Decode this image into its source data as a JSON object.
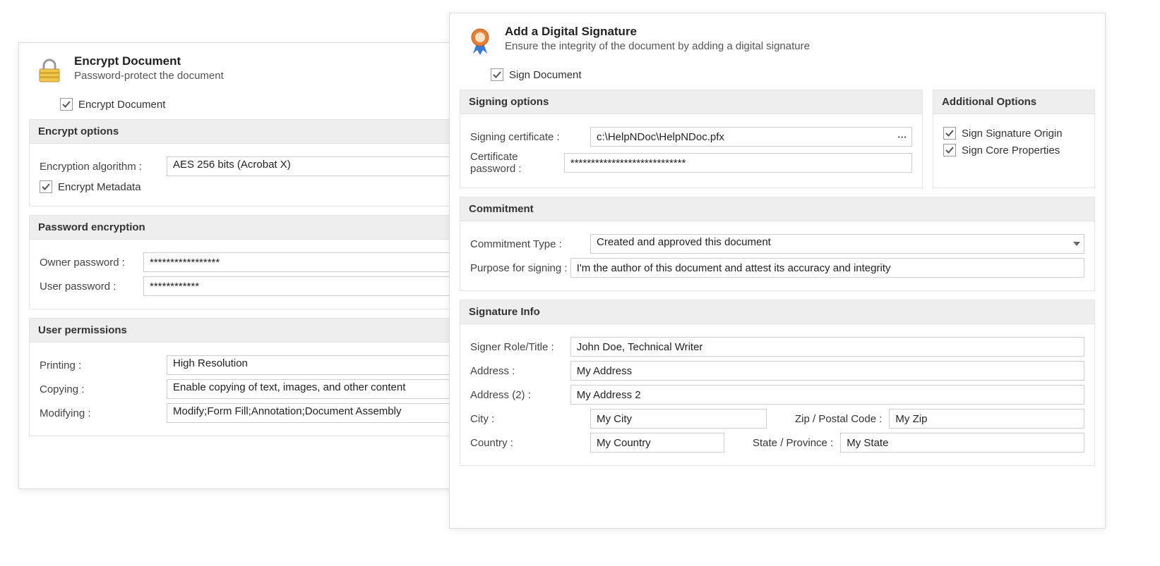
{
  "encrypt": {
    "title": "Encrypt Document",
    "desc": "Password-protect the document",
    "check_label": "Encrypt Document",
    "options": {
      "heading": "Encrypt options",
      "algo_label": "Encryption algorithm :",
      "algo_value": "AES 256 bits (Acrobat X)",
      "meta_label": "Encrypt Metadata"
    },
    "pw": {
      "heading": "Password encryption",
      "owner_label": "Owner password :",
      "owner_value": "*****************",
      "user_label": "User password :",
      "user_value": "************"
    },
    "perm": {
      "heading": "User permissions",
      "print_label": "Printing :",
      "print_value": "High Resolution",
      "copy_label": "Copying :",
      "copy_value": "Enable copying of text, images, and other content",
      "mod_label": "Modifying :",
      "mod_value": "Modify;Form Fill;Annotation;Document Assembly"
    }
  },
  "sign": {
    "title": "Add a Digital Signature",
    "desc": "Ensure the integrity of the document by adding a digital signature",
    "check_label": "Sign Document",
    "options": {
      "heading": "Signing options",
      "cert_label": "Signing certificate :",
      "cert_value": "c:\\HelpNDoc\\HelpNDoc.pfx",
      "pwd_label": "Certificate password :",
      "pwd_value": "****************************"
    },
    "additional": {
      "heading": "Additional Options",
      "origin_label": "Sign Signature Origin",
      "core_label": "Sign Core Properties"
    },
    "commitment": {
      "heading": "Commitment",
      "type_label": "Commitment Type :",
      "type_value": "Created and approved this document",
      "purpose_label": "Purpose for signing :",
      "purpose_value": "I'm the author of this document and attest its accuracy and integrity"
    },
    "info": {
      "heading": "Signature Info",
      "role_label": "Signer Role/Title :",
      "role_value": "John Doe, Technical Writer",
      "addr_label": "Address :",
      "addr_value": "My Address",
      "addr2_label": "Address (2) :",
      "addr2_value": "My Address 2",
      "city_label": "City :",
      "city_value": "My City",
      "zip_label": "Zip / Postal Code :",
      "zip_value": "My Zip",
      "country_label": "Country :",
      "country_value": "My Country",
      "state_label": "State / Province :",
      "state_value": "My State"
    }
  }
}
